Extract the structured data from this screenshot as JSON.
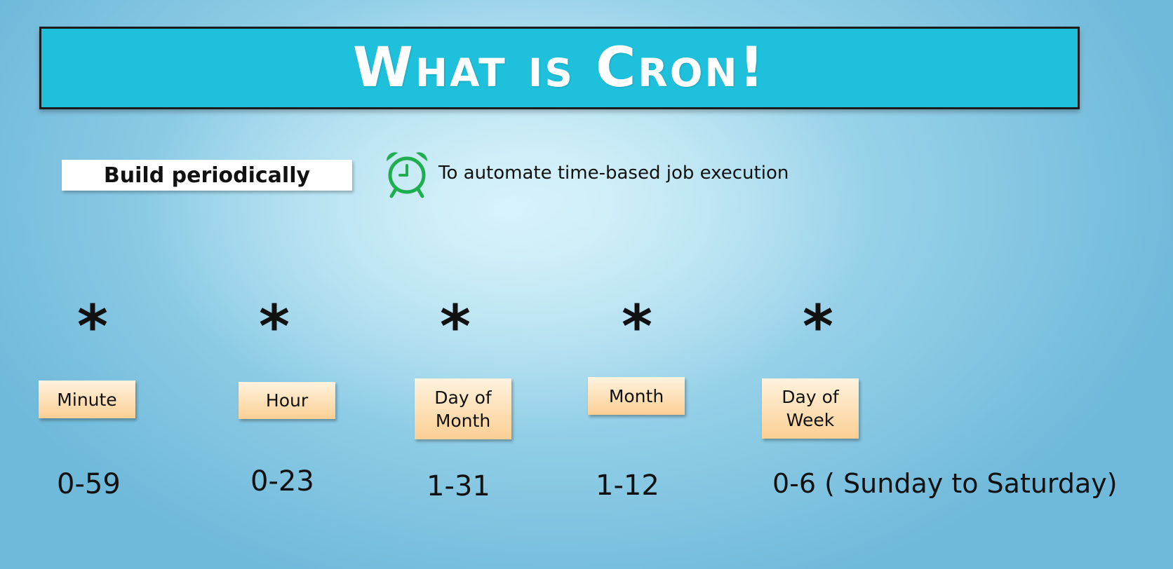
{
  "slide": {
    "title": "What is Cron!",
    "build_label": "Build periodically",
    "description": "To automate time-based job execution"
  },
  "cron_fields": [
    {
      "symbol": "*",
      "label": "Minute",
      "range": "0-59"
    },
    {
      "symbol": "*",
      "label": "Hour",
      "range": "0-23"
    },
    {
      "symbol": "*",
      "label": "Day of\nMonth",
      "range": "1-31"
    },
    {
      "symbol": "*",
      "label": "Month",
      "range": "1-12"
    },
    {
      "symbol": "*",
      "label": "Day of\nWeek",
      "range": "0-6 ( Sunday to Saturday)"
    }
  ],
  "colors": {
    "banner": "#1ec0db",
    "label_box": "#fbcf93",
    "alarm_icon": "#1fae4f"
  },
  "icons": {
    "alarm": "alarm-clock-icon"
  }
}
